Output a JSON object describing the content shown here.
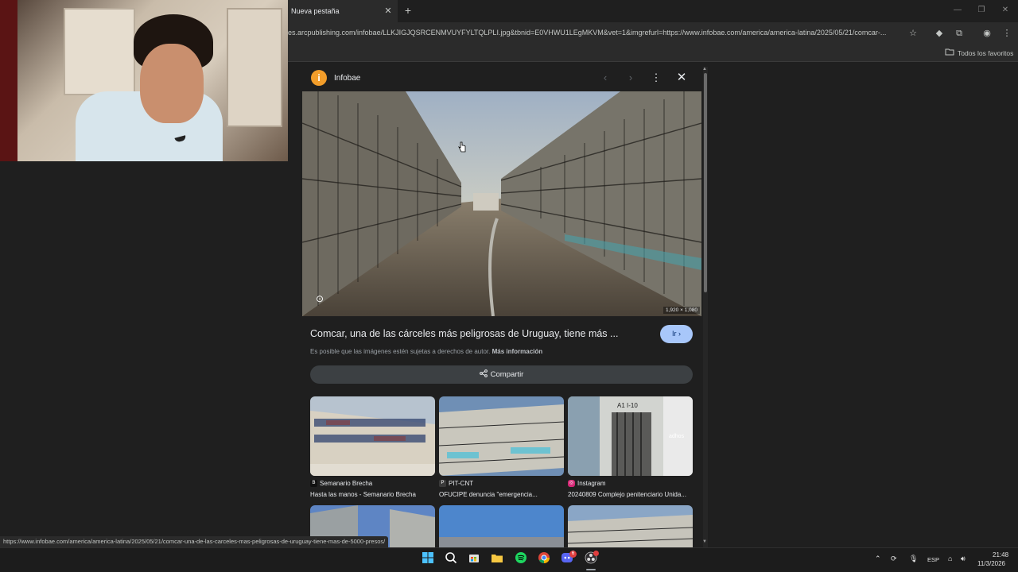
{
  "browser": {
    "tab_title": "Nueva pestaña",
    "url": "es.arcpublishing.com/infobae/LLKJIGJQSRCENMVUYFYLTQLPLI.jpg&tbnid=E0VHWU1LEgMKVM&vet=1&imgrefurl=https://www.infobae.com/america/america-latina/2025/05/21/comcar-...",
    "bookmarks_label": "Todos los favoritos",
    "status_url": "https://www.infobae.com/america/america-latina/2025/05/21/comcar-una-de-las-carceles-mas-peligrosas-de-uruguay-tiene-mas-de-5000-presos/"
  },
  "panel": {
    "source_name": "Infobae",
    "source_logo_letter": "i",
    "image_dimensions": "1,920 × 1,080",
    "title": "Comcar, una de las cárceles más peligrosas de Uruguay, tiene más ...",
    "go_label": "Ir",
    "copyright_text": "Es posible que las imágenes estén sujetas a derechos de autor.",
    "copyright_link": "Más información",
    "share_label": "Compartir",
    "related": [
      {
        "source": "Semanario Brecha",
        "title": "Hasta las manos - Semanario Brecha",
        "icon_letter": "B",
        "icon_color": "#111111"
      },
      {
        "source": "PIT-CNT",
        "title": "OFUCIPE denuncia \"emergencia...",
        "icon_letter": "P",
        "icon_color": "#3a3a3a"
      },
      {
        "source": "Instagram",
        "title": "20240809 Complejo penitenciario Unida...",
        "icon_letter": "◎",
        "icon_color": "#d62976"
      }
    ],
    "related_photo_text": "adhos"
  },
  "system": {
    "language": "ESP",
    "time": "21:48",
    "date": "11/3/2026",
    "chat_badge": "6"
  }
}
